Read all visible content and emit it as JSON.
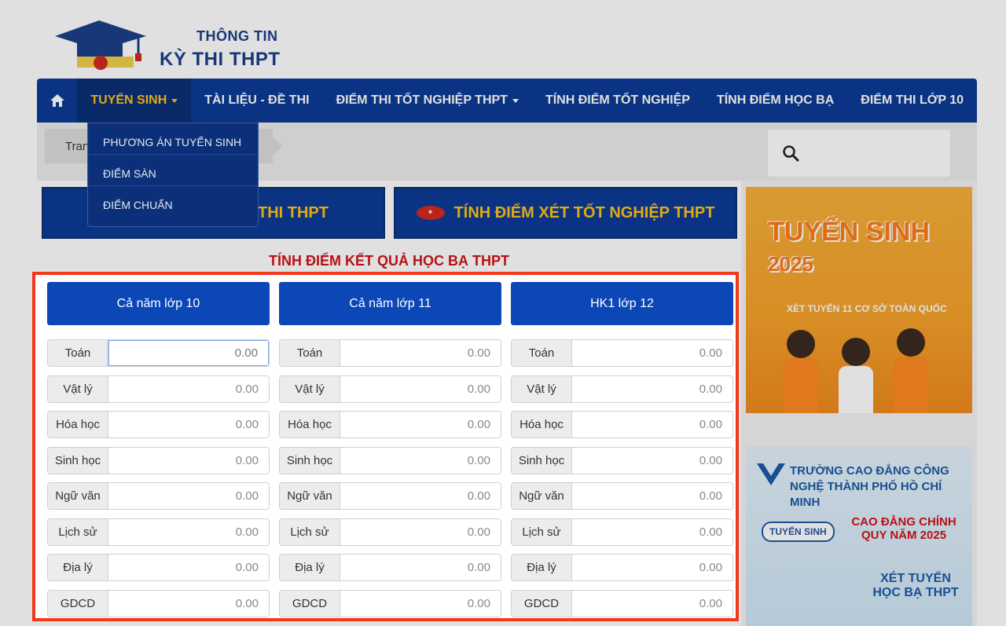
{
  "logo": {
    "line1": "THÔNG TIN",
    "line2": "KỲ THI THPT"
  },
  "nav": {
    "items": [
      {
        "label": "TUYỂN SINH"
      },
      {
        "label": "TÀI LIỆU - ĐỀ THI"
      },
      {
        "label": "ĐIỂM THI TỐT NGHIỆP THPT"
      },
      {
        "label": "TÍNH ĐIỂM TỐT NGHIỆP"
      },
      {
        "label": "TÍNH ĐIỂM HỌC BẠ"
      },
      {
        "label": "ĐIỂM THI LỚP 10"
      }
    ]
  },
  "dropdown": {
    "items": [
      "PHƯƠNG ÁN TUYỂN SINH",
      "ĐIỂM SÀN",
      "ĐIỂM CHUẨN"
    ]
  },
  "breadcrumb": {
    "label": "Tran",
    "suffix": "a"
  },
  "banners": {
    "left": "THI THPT",
    "right": "TÍNH ĐIỂM XÉT TỐT NGHIỆP THPT"
  },
  "section_title": "TÍNH ĐIỂM KẾT QUẢ HỌC BẠ THPT",
  "form": {
    "columns": [
      "Cả năm lớp 10",
      "Cả năm lớp 11",
      "HK1 lớp 12"
    ],
    "subjects": [
      "Toán",
      "Vật lý",
      "Hóa học",
      "Sinh học",
      "Ngữ văn",
      "Lịch sử",
      "Địa lý",
      "GDCD"
    ],
    "default_value": "0.00"
  },
  "ads": {
    "ad1": {
      "title_line1": "TUYỂN SINH",
      "title_line2": "2025",
      "tagline": "XÉT TUYỂN 11 CƠ SỞ TOÀN QUỐC"
    },
    "ad2": {
      "title": "TRƯỜNG CAO ĐẲNG CÔNG NGHỆ THÀNH PHỐ HỒ CHÍ MINH",
      "tag": "TUYỂN SINH",
      "subtitle": "CAO ĐẲNG CHÍNH QUY NĂM 2025",
      "cta": "XÉT TUYỂN HỌC BẠ THPT"
    }
  },
  "colors": {
    "nav": "#0c3c96",
    "accent": "#ffc21a",
    "highlight": "#f2391c",
    "button": "#0c47b7",
    "title_red": "#d0141a"
  }
}
